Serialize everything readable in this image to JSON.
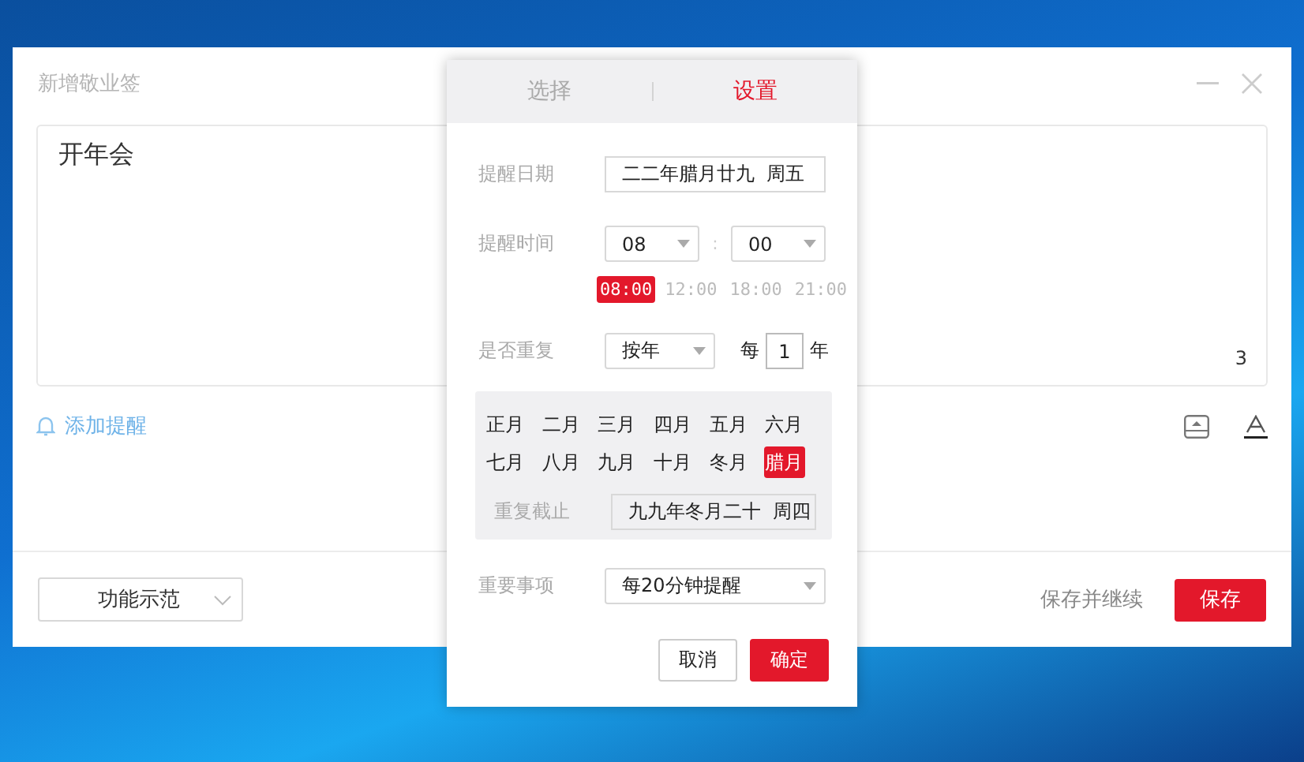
{
  "window": {
    "title": "新增敬业签",
    "note_text": "开年会",
    "char_count": "3",
    "add_reminder": "添加提醒",
    "demo_select": "功能示范",
    "save_continue": "保存并继续",
    "save": "保存"
  },
  "popup": {
    "tabs": [
      {
        "label": "选择",
        "selected": false
      },
      {
        "label": "设置",
        "selected": true
      }
    ],
    "date": {
      "label": "提醒日期",
      "value": "二二年腊月廿九  周五"
    },
    "time": {
      "label": "提醒时间",
      "hour": "08",
      "separator": ":",
      "minute": "00",
      "presets": [
        {
          "label": "08:00",
          "selected": true
        },
        {
          "label": "12:00",
          "selected": false
        },
        {
          "label": "18:00",
          "selected": false
        },
        {
          "label": "21:00",
          "selected": false
        }
      ]
    },
    "repeat": {
      "label": "是否重复",
      "mode": "按年",
      "every": "每",
      "count": "1",
      "unit": "年"
    },
    "months": [
      {
        "label": "正月",
        "selected": false
      },
      {
        "label": "二月",
        "selected": false
      },
      {
        "label": "三月",
        "selected": false
      },
      {
        "label": "四月",
        "selected": false
      },
      {
        "label": "五月",
        "selected": false
      },
      {
        "label": "六月",
        "selected": false
      },
      {
        "label": "七月",
        "selected": false
      },
      {
        "label": "八月",
        "selected": false
      },
      {
        "label": "九月",
        "selected": false
      },
      {
        "label": "十月",
        "selected": false
      },
      {
        "label": "冬月",
        "selected": false
      },
      {
        "label": "腊月",
        "selected": true
      }
    ],
    "repeat_end": {
      "label": "重复截止",
      "value": "九九年冬月二十  周四"
    },
    "important": {
      "label": "重要事项",
      "value": "每20分钟提醒"
    },
    "buttons": [
      {
        "label": "取消",
        "kind": "secondary"
      },
      {
        "label": "确定",
        "kind": "primary"
      }
    ]
  }
}
